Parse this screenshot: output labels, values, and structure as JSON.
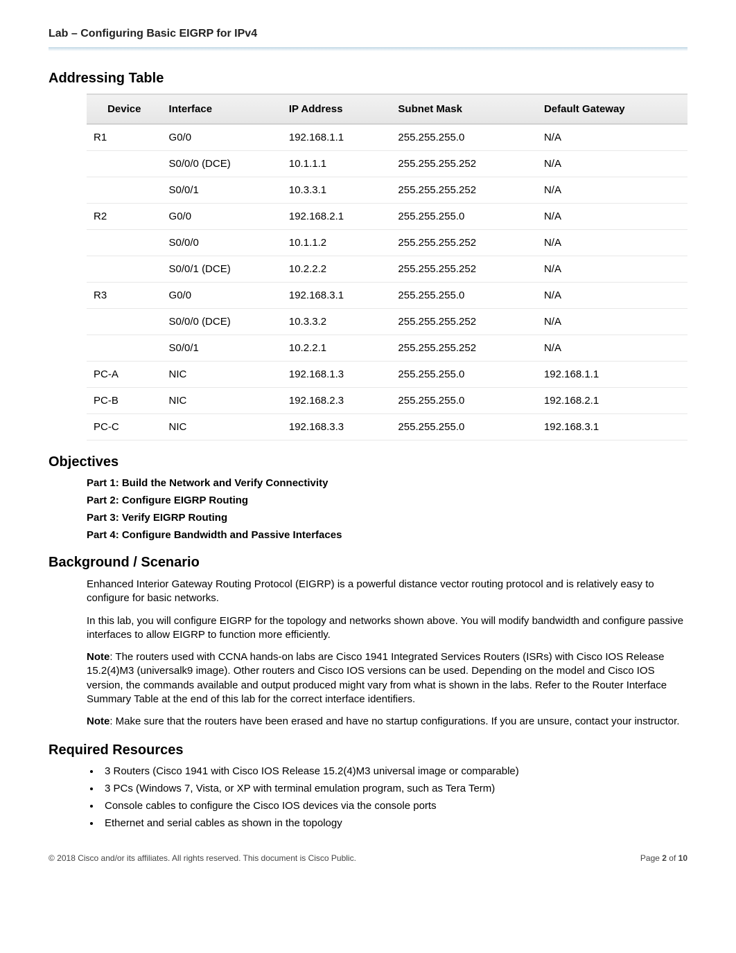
{
  "header": {
    "title": "Lab – Configuring Basic EIGRP for IPv4"
  },
  "addressing": {
    "heading": "Addressing Table",
    "columns": {
      "device": "Device",
      "interface": "Interface",
      "ip": "IP Address",
      "mask": "Subnet Mask",
      "gateway": "Default Gateway"
    },
    "rows": [
      {
        "device": "R1",
        "interface": "G0/0",
        "ip": "192.168.1.1",
        "mask": "255.255.255.0",
        "gateway": "N/A"
      },
      {
        "device": "",
        "interface": "S0/0/0 (DCE)",
        "ip": "10.1.1.1",
        "mask": "255.255.255.252",
        "gateway": "N/A"
      },
      {
        "device": "",
        "interface": "S0/0/1",
        "ip": "10.3.3.1",
        "mask": "255.255.255.252",
        "gateway": "N/A"
      },
      {
        "device": "R2",
        "interface": "G0/0",
        "ip": "192.168.2.1",
        "mask": "255.255.255.0",
        "gateway": "N/A"
      },
      {
        "device": "",
        "interface": "S0/0/0",
        "ip": "10.1.1.2",
        "mask": "255.255.255.252",
        "gateway": "N/A"
      },
      {
        "device": "",
        "interface": "S0/0/1 (DCE)",
        "ip": "10.2.2.2",
        "mask": "255.255.255.252",
        "gateway": "N/A"
      },
      {
        "device": "R3",
        "interface": "G0/0",
        "ip": "192.168.3.1",
        "mask": "255.255.255.0",
        "gateway": "N/A"
      },
      {
        "device": "",
        "interface": "S0/0/0 (DCE)",
        "ip": "10.3.3.2",
        "mask": "255.255.255.252",
        "gateway": "N/A"
      },
      {
        "device": "",
        "interface": "S0/0/1",
        "ip": "10.2.2.1",
        "mask": "255.255.255.252",
        "gateway": "N/A"
      },
      {
        "device": "PC-A",
        "interface": "NIC",
        "ip": "192.168.1.3",
        "mask": "255.255.255.0",
        "gateway": "192.168.1.1"
      },
      {
        "device": "PC-B",
        "interface": "NIC",
        "ip": "192.168.2.3",
        "mask": "255.255.255.0",
        "gateway": "192.168.2.1"
      },
      {
        "device": "PC-C",
        "interface": "NIC",
        "ip": "192.168.3.3",
        "mask": "255.255.255.0",
        "gateway": "192.168.3.1"
      }
    ]
  },
  "objectives": {
    "heading": "Objectives",
    "parts": [
      "Part 1: Build the Network and Verify Connectivity",
      "Part 2: Configure EIGRP Routing",
      "Part 3: Verify EIGRP Routing",
      "Part 4: Configure Bandwidth and Passive Interfaces"
    ]
  },
  "background": {
    "heading": "Background / Scenario",
    "p1": "Enhanced Interior Gateway Routing Protocol (EIGRP) is a powerful distance vector routing protocol and is relatively easy to configure for basic networks.",
    "p2": "In this lab, you will configure EIGRP for the topology and networks shown above. You will modify bandwidth and configure passive interfaces to allow EIGRP to function more efficiently.",
    "note1_label": "Note",
    "note1_text": ": The routers used with CCNA hands-on labs are Cisco 1941 Integrated Services Routers (ISRs) with Cisco IOS Release 15.2(4)M3 (universalk9 image). Other routers and Cisco IOS versions can be used. Depending on the model and Cisco IOS version, the commands available and output produced might vary from what is shown in the labs. Refer to the Router Interface Summary Table at the end of this lab for the correct interface identifiers.",
    "note2_label": "Note",
    "note2_text": ": Make sure that the routers have been erased and have no startup configurations. If you are unsure, contact your instructor."
  },
  "resources": {
    "heading": "Required Resources",
    "items": [
      "3 Routers (Cisco 1941 with Cisco IOS Release 15.2(4)M3 universal image or comparable)",
      "3 PCs (Windows 7, Vista, or XP with terminal emulation program, such as Tera Term)",
      "Console cables to configure the Cisco IOS devices via the console ports",
      "Ethernet and serial cables as shown in the topology"
    ]
  },
  "footer": {
    "left": "© 2018 Cisco and/or its affiliates. All rights reserved. This document is Cisco Public.",
    "right_prefix": "Page ",
    "right_page": "2",
    "right_of": " of ",
    "right_total": "10"
  }
}
